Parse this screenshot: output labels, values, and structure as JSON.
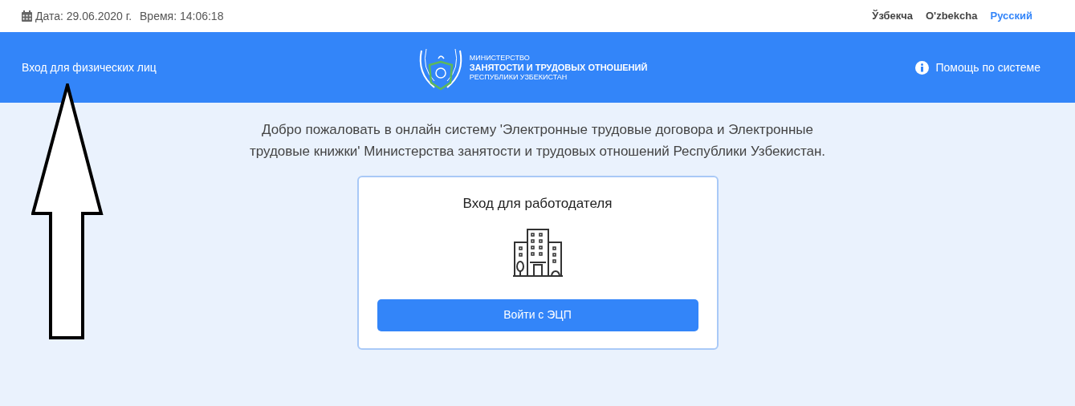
{
  "top_bar": {
    "date_label": "Дата: 29.06.2020 г.",
    "time_label": "Время: 14:06:18",
    "languages": [
      {
        "label": "Ўзбекча",
        "selected": false
      },
      {
        "label": "O'zbekcha",
        "selected": false
      },
      {
        "label": "Русский",
        "selected": true
      }
    ]
  },
  "header": {
    "login_link": "Вход для физических лиц",
    "logo_lines": [
      "МИНИСТЕРСТВО",
      "ЗАНЯТОСТИ И ТРУДОВЫХ ОТНОШЕНИЙ",
      "РЕСПУБЛИКИ УЗБЕКИСТАН"
    ],
    "help_link": "Помощь по системе"
  },
  "welcome_text": "Добро пожаловать в онлайн систему 'Электронные трудовые договора и Электронные трудовые книжки' Министерства занятости и трудовых отношений Республики Узбекистан.",
  "employer_card": {
    "title": "Вход для работодателя",
    "button": "Войти с ЭЦП"
  }
}
